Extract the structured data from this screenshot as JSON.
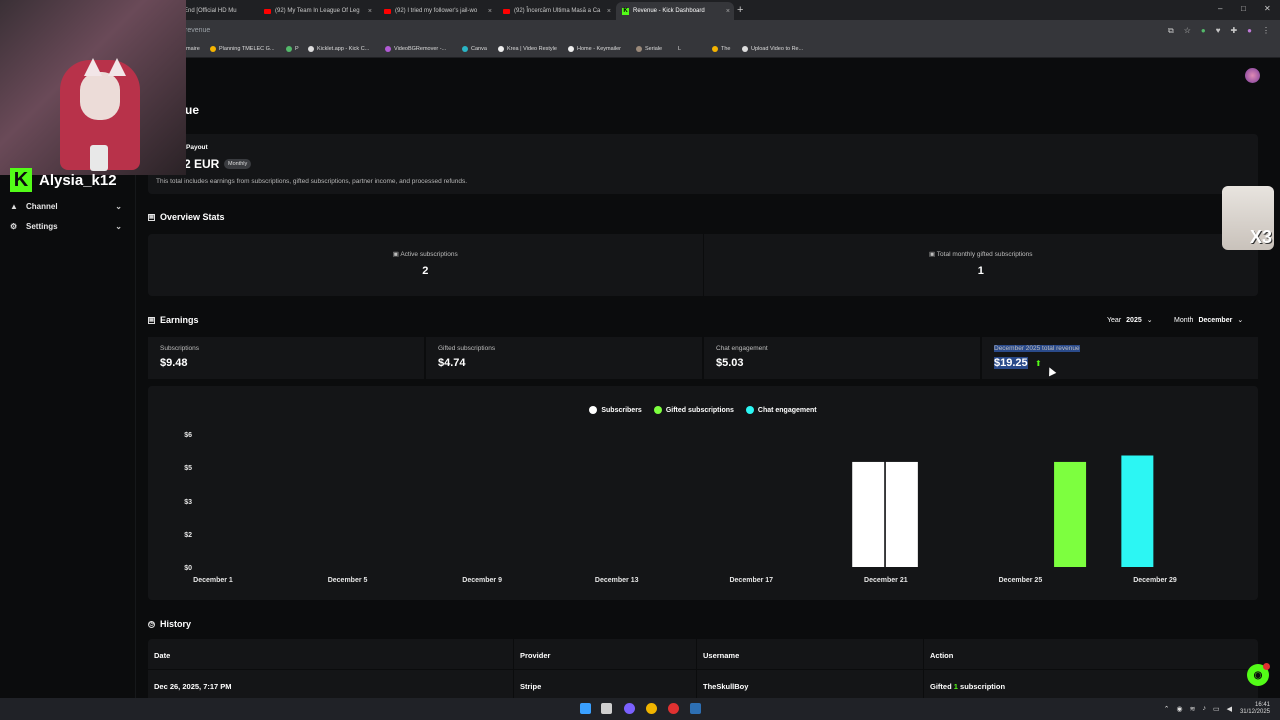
{
  "browser": {
    "tabs": [
      {
        "label": "End [Official HD Mu",
        "kind": "youtube"
      },
      {
        "label": "(92) My Team In League Of Leg",
        "kind": "youtube"
      },
      {
        "label": "(92) I tried my follower's jail-wo",
        "kind": "youtube"
      },
      {
        "label": "(92) Încercăm Ultima Masă a Ca",
        "kind": "youtube"
      },
      {
        "label": "Revenue - Kick Dashboard",
        "kind": "kick"
      }
    ],
    "new_tab": "+",
    "address": "revenue",
    "bookmarks": [
      "maire",
      "Planning TMELEC G...",
      "P",
      "Kicklet.app - Kick C...",
      "VideoBGRemover -...",
      "Canva",
      "Krea | Video Restyle",
      "Home - Keymailer",
      "Seriale",
      "L",
      "The",
      "Upload Video to Re..."
    ]
  },
  "sidebar": {
    "channel_name": "Alysia_k12",
    "logo_letter": "K",
    "items": [
      {
        "label": "Channel",
        "icon": "user-icon"
      },
      {
        "label": "Settings",
        "icon": "gear-icon"
      }
    ]
  },
  "header": {
    "title_fragment": "ue"
  },
  "payout": {
    "label": "Payout",
    "amount": "2 EUR",
    "badge": "Monthly",
    "note": "This total includes earnings from subscriptions, gifted subscriptions, partner income, and processed refunds."
  },
  "overview": {
    "title": "Overview Stats",
    "stats": [
      {
        "label": "Active subscriptions",
        "value": "2"
      },
      {
        "label": "Total monthly gifted subscriptions",
        "value": "1"
      }
    ]
  },
  "earnings": {
    "title": "Earnings",
    "year_label": "Year",
    "year_value": "2025",
    "month_label": "Month",
    "month_value": "December",
    "cards": [
      {
        "label": "Subscriptions",
        "value": "$9.48"
      },
      {
        "label": "Gifted subscriptions",
        "value": "$4.74"
      },
      {
        "label": "Chat engagement",
        "value": "$5.03"
      },
      {
        "label": "December 2025 total revenue",
        "value": "$19.25"
      }
    ]
  },
  "chart_data": {
    "type": "bar",
    "series": [
      {
        "name": "Subscribers",
        "color": "#ffffff"
      },
      {
        "name": "Gifted subscriptions",
        "color": "#7dff3f"
      },
      {
        "name": "Chat engagement",
        "color": "#2cf6f3"
      }
    ],
    "y_ticks": [
      "$6",
      "$5",
      "$3",
      "$2",
      "$0"
    ],
    "x_ticks": [
      "December 1",
      "December 5",
      "December 9",
      "December 13",
      "December 17",
      "December 21",
      "December 25",
      "December 29"
    ],
    "ylim": [
      0,
      6
    ],
    "bars": [
      {
        "date": "December 20",
        "series": "Subscribers",
        "value": 4.74
      },
      {
        "date": "December 21",
        "series": "Subscribers",
        "value": 4.74
      },
      {
        "date": "December 26",
        "series": "Gifted subscriptions",
        "value": 4.74
      },
      {
        "date": "December 28",
        "series": "Chat engagement",
        "value": 5.03
      }
    ]
  },
  "history": {
    "title": "History",
    "columns": [
      "Date",
      "Provider",
      "Username",
      "Action"
    ],
    "rows": [
      {
        "date": "Dec 26, 2025, 7:17 PM",
        "provider": "Stripe",
        "username": "TheSkullBoy",
        "action_pre": "Gifted",
        "action_num": "1",
        "action_post": "subscription"
      }
    ]
  },
  "taskbar": {
    "time": "16:41",
    "date": "31/12/2025"
  },
  "overlay": {
    "cat_text": "X3"
  }
}
